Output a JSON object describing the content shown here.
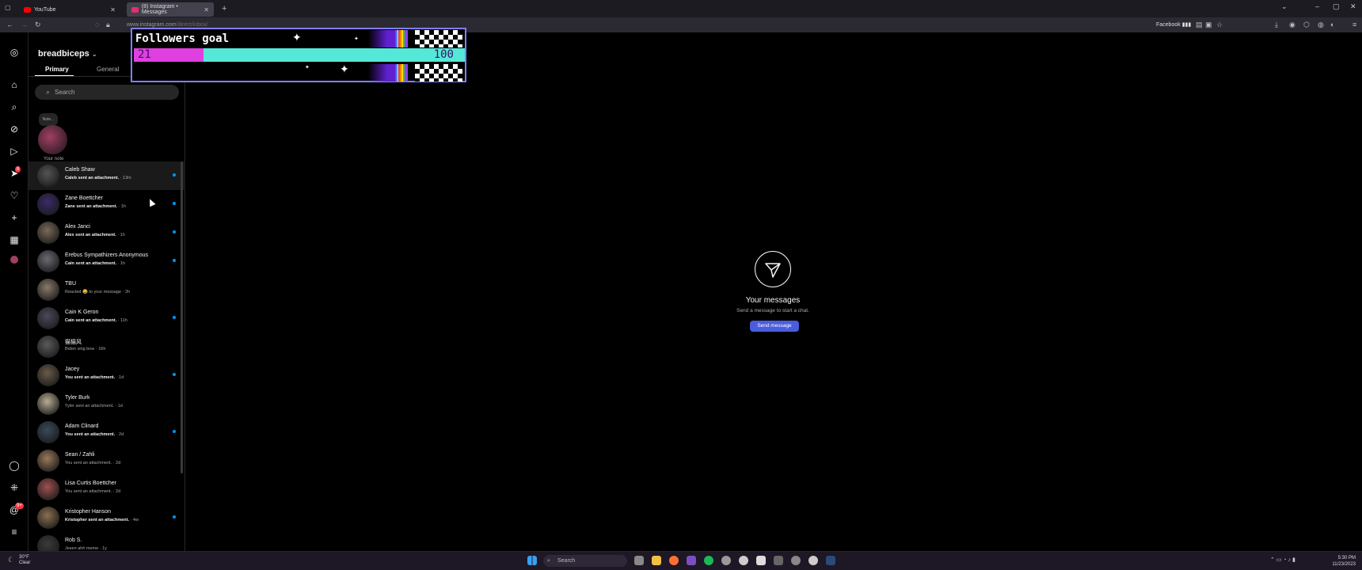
{
  "browser": {
    "tabs": [
      {
        "label": "YouTube",
        "favicon_color": "#ff0000"
      },
      {
        "label": "(8) Instagram • Messages",
        "favicon_color": "#e1306c"
      }
    ],
    "url_domain": "www.instagram.com",
    "url_path": "/direct/inbox/",
    "bookmark": "Facebook"
  },
  "overlay": {
    "title": "Followers goal",
    "current": "21",
    "goal": "100",
    "progress_fraction": 0.21
  },
  "rail": {
    "notifications_badge": "8",
    "threads_badge": "9+"
  },
  "inbox": {
    "username": "breadbiceps",
    "tab_primary": "Primary",
    "tab_general": "General",
    "search_placeholder": "Search",
    "note_bubble": "Note...",
    "note_label": "Your note",
    "threads": [
      {
        "name": "Caleb Shaw",
        "preview": "Caleb sent an attachment.",
        "time": " · 13m",
        "unread": true,
        "color": "#555"
      },
      {
        "name": "Zane Boettcher",
        "preview": "Zane sent an attachment.",
        "time": " · 1h",
        "unread": true,
        "color": "#3b2a6a"
      },
      {
        "name": "Alex Janci",
        "preview": "Alex sent an attachment.",
        "time": " · 1h",
        "unread": true,
        "color": "#7a6a5a"
      },
      {
        "name": "Erebus Sympathizers Anonymous",
        "preview": "Cain sent an attachment.",
        "time": " · 1h",
        "unread": true,
        "color": "#6a6a72"
      },
      {
        "name": "TBU",
        "preview": "Reacted 😂 to your message",
        "time": " · 2h",
        "unread": false,
        "color": "#8a7a6a"
      },
      {
        "name": "Cain K Geron",
        "preview": "Cain sent an attachment.",
        "time": " · 11h",
        "unread": true,
        "color": "#4a4a5a"
      },
      {
        "name": "猫猫风",
        "preview": "Biden sing bow",
        "time": " · 16h",
        "unread": false,
        "color": "#5a5a5a"
      },
      {
        "name": "Jacey",
        "preview": "You sent an attachment.",
        "time": " · 1d",
        "unread": true,
        "color": "#6a5a4a"
      },
      {
        "name": "Tyler Burk",
        "preview": "Tyler sent an attachment.",
        "time": " · 1d",
        "unread": false,
        "color": "#b8ae94"
      },
      {
        "name": "Adam Clinard",
        "preview": "You sent an attachment.",
        "time": " · 2d",
        "unread": true,
        "color": "#3a4a5a"
      },
      {
        "name": "Sean / Zahli",
        "preview": "You sent an attachment.",
        "time": " · 2d",
        "unread": false,
        "color": "#9a7a5a"
      },
      {
        "name": "Lisa Curtis Boettcher",
        "preview": "You sent an attachment.",
        "time": " · 2d",
        "unread": false,
        "color": "#a05050"
      },
      {
        "name": "Kristopher Hanson",
        "preview": "Kristopher sent an attachment.",
        "time": " · 4w",
        "unread": true,
        "color": "#8a7050"
      },
      {
        "name": "Rob S.",
        "preview": "Jesen ahh meme",
        "time": " · 1y",
        "unread": false,
        "color": "#3a3a3a"
      }
    ]
  },
  "main": {
    "title": "Your messages",
    "subtitle": "Send a message to start a chat.",
    "button": "Send message"
  },
  "taskbar": {
    "weather_temp": "30°F",
    "weather_desc": "Clear",
    "search": "Search",
    "time": "5:30 PM",
    "date": "11/23/2023"
  },
  "colors": {
    "accent": "#4a5dde",
    "unread_dot": "#0095f6",
    "overlay_fill": "#e040e0",
    "overlay_track": "#55e8d8"
  }
}
